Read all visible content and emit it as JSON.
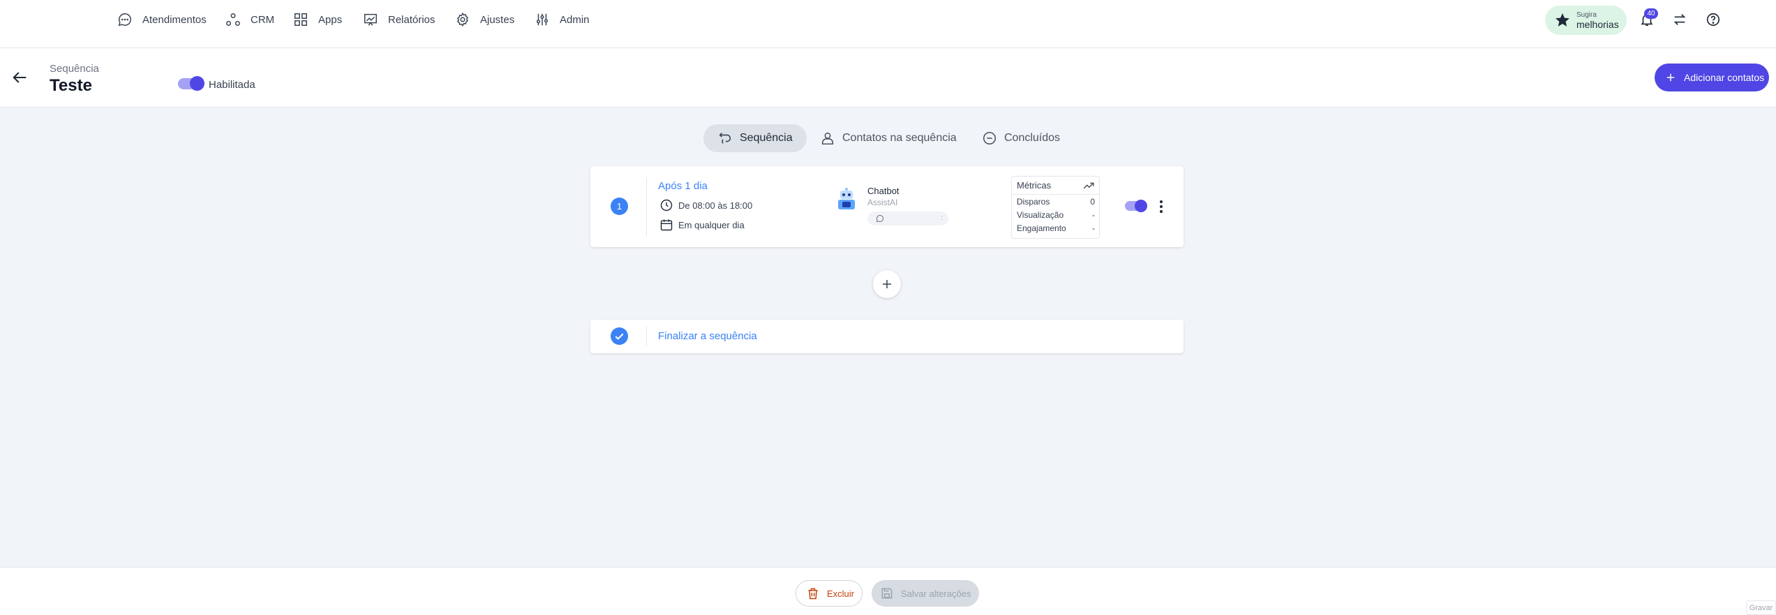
{
  "nav": {
    "items": [
      {
        "label": "Atendimentos",
        "icon": "chat-bubble-icon"
      },
      {
        "label": "CRM",
        "icon": "crm-nodes-icon"
      },
      {
        "label": "Apps",
        "icon": "apps-grid-icon"
      },
      {
        "label": "Relatórios",
        "icon": "report-chart-icon"
      },
      {
        "label": "Ajustes",
        "icon": "gear-icon"
      },
      {
        "label": "Admin",
        "icon": "sliders-icon"
      }
    ],
    "suggest_line1": "Sugira",
    "suggest_line2": "melhorias",
    "notifications_count": "40"
  },
  "header": {
    "subtitle": "Sequência",
    "title": "Teste",
    "enabled_label": "Habilitada",
    "add_contacts_label": "Adicionar contatos"
  },
  "tabs": [
    {
      "label": "Sequência",
      "active": true
    },
    {
      "label": "Contatos na sequência",
      "active": false
    },
    {
      "label": "Concluídos",
      "active": false
    }
  ],
  "step": {
    "number": "1",
    "title": "Após 1 dia",
    "time_range": "De 08:00 às 18:00",
    "days": "Em qualquer dia",
    "bot_name": "Chatbot",
    "bot_sub": "AssistAI",
    "channel_suffix": ":",
    "metrics": {
      "title": "Métricas",
      "rows": [
        {
          "label": "Disparos",
          "value": "0"
        },
        {
          "label": "Visualização",
          "value": "-"
        },
        {
          "label": "Engajamento",
          "value": "-"
        }
      ]
    }
  },
  "final": {
    "title": "Finalizar a sequência"
  },
  "footer": {
    "delete_label": "Excluir",
    "save_label": "Salvar alterações",
    "record_label": "Gravar"
  },
  "colors": {
    "primary": "#4f46e5",
    "accent_blue": "#3b82f6",
    "danger": "#c2410c",
    "suggest_bg": "#dcf4e6"
  }
}
